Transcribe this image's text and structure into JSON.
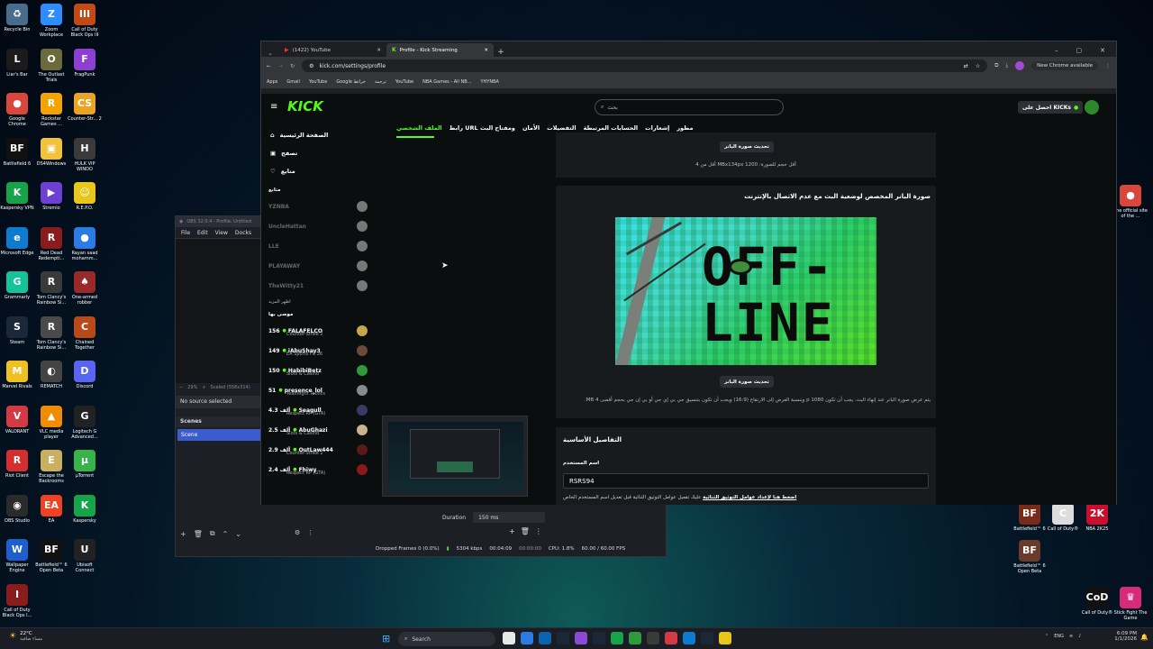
{
  "desktop_left": [
    {
      "label": "Recycle Bin",
      "color": "#4a6c8c",
      "glyph": "♻"
    },
    {
      "label": "Zoom Workplace",
      "color": "#2d8cff",
      "glyph": "Z"
    },
    {
      "label": "Call of Duty Black Ops III",
      "color": "#c24a14",
      "glyph": "III"
    },
    {
      "label": "Liar's Bar",
      "color": "#1b1b1b",
      "glyph": "L"
    },
    {
      "label": "The Outlast Trials",
      "color": "#6b6a3c",
      "glyph": "O"
    },
    {
      "label": "FragPunk",
      "color": "#8c3fd0",
      "glyph": "F"
    },
    {
      "label": "Google Chrome",
      "color": "#d9473c",
      "glyph": "●"
    },
    {
      "label": "Rockstar Games ...",
      "color": "#f4a300",
      "glyph": "R"
    },
    {
      "label": "Counter-Str... 2",
      "color": "#e8a422",
      "glyph": "CS"
    },
    {
      "label": "Battlefield 6",
      "color": "#111",
      "glyph": "BF"
    },
    {
      "label": "DS4Windows",
      "color": "#f2c23a",
      "glyph": "▣"
    },
    {
      "label": "HULK VIP WINDO",
      "color": "#3a3a3a",
      "glyph": "H"
    },
    {
      "label": "Kaspersky VPN",
      "color": "#17a34a",
      "glyph": "K"
    },
    {
      "label": "Stremio",
      "color": "#6d3fd2",
      "glyph": "▶"
    },
    {
      "label": "R.E.P.O.",
      "color": "#e8c61a",
      "glyph": "☺"
    },
    {
      "label": "Microsoft Edge",
      "color": "#0c7bd0",
      "glyph": "e"
    },
    {
      "label": "Red Dead Redempti...",
      "color": "#8a1c1c",
      "glyph": "R"
    },
    {
      "label": "Rayan saad mohamm...",
      "color": "#2a7be4",
      "glyph": "●"
    },
    {
      "label": "Grammarly",
      "color": "#15c39a",
      "glyph": "G"
    },
    {
      "label": "Tom Clancy's Rainbow Si...",
      "color": "#3a3a3a",
      "glyph": "R"
    },
    {
      "label": "One-armed robber",
      "color": "#9a2a2a",
      "glyph": "♠"
    },
    {
      "label": "Steam",
      "color": "#1b2838",
      "glyph": "S"
    },
    {
      "label": "Tom Clancy's Rainbow Si...",
      "color": "#4a4a4a",
      "glyph": "R"
    },
    {
      "label": "Chained Together",
      "color": "#b84a1a",
      "glyph": "C"
    },
    {
      "label": "Marvel Rivals",
      "color": "#f0c020",
      "glyph": "M"
    },
    {
      "label": "REMATCH",
      "color": "#444",
      "glyph": "◐"
    },
    {
      "label": "Discord",
      "color": "#5865f2",
      "glyph": "D"
    },
    {
      "label": "VALORANT",
      "color": "#d33a44",
      "glyph": "V"
    },
    {
      "label": "VLC media player",
      "color": "#f08c00",
      "glyph": "▲"
    },
    {
      "label": "Logitech G Advanced...",
      "color": "#222",
      "glyph": "G"
    },
    {
      "label": "Riot Client",
      "color": "#d42e2e",
      "glyph": "R"
    },
    {
      "label": "Escape the Backrooms",
      "color": "#c8b060",
      "glyph": "E"
    },
    {
      "label": "µTorrent",
      "color": "#38b34a",
      "glyph": "µ"
    },
    {
      "label": "OBS Studio",
      "color": "#2b2b2b",
      "glyph": "◉"
    },
    {
      "label": "EA",
      "color": "#f04123",
      "glyph": "EA"
    },
    {
      "label": "Kaspersky",
      "color": "#17a34a",
      "glyph": "K"
    },
    {
      "label": "Wallpaper Engine",
      "color": "#1e5fd0",
      "glyph": "W"
    },
    {
      "label": "Battlefield™ 6 Open Beta",
      "color": "#111",
      "glyph": "BF"
    },
    {
      "label": "Ubisoft Connect",
      "color": "#222",
      "glyph": "U"
    },
    {
      "label": "Call of Duty Black Ops I...",
      "color": "#8a1c1c",
      "glyph": "I"
    }
  ],
  "desktop_right": [
    {
      "label": "The official site of the ...",
      "color": "#d9473c",
      "glyph": "●"
    },
    {
      "label": "Battlefield™ 6",
      "color": "#7a2a1a",
      "glyph": "BF"
    },
    {
      "label": "Call of Duty®",
      "color": "#dddddd",
      "glyph": "C"
    },
    {
      "label": "NBA 2K25",
      "color": "#c8102e",
      "glyph": "2K"
    },
    {
      "label": "Battlefield™ 6 Open Beta",
      "color": "#6a3a2a",
      "glyph": "BF"
    },
    {
      "label": "Call of Duty®",
      "color": "#111",
      "glyph": "CoD"
    },
    {
      "label": "Stick Fight The Game",
      "color": "#d82a7a",
      "glyph": "♛"
    }
  ],
  "obs": {
    "title": "OBS 32.0.4 - Profile: Untitled",
    "menu": [
      "File",
      "Edit",
      "View",
      "Docks"
    ],
    "zoom": "29%",
    "scaled": "Scaled (558x314)",
    "no_source": "No source selected",
    "scenes_title": "Scenes",
    "scene_item": "Scene",
    "duration_label": "Duration",
    "duration_value": "150 ms",
    "status": {
      "dropped": "Dropped Frames 0 (0.0%)",
      "kbps": "5304 kbps",
      "time1": "00:04:09",
      "time2": "00:00:00",
      "cpu": "CPU: 1.8%",
      "fps": "60.00 / 60.00 FPS"
    }
  },
  "chrome": {
    "tabs": [
      "(1422) YouTube",
      "Profile - Kick Streaming"
    ],
    "url": "kick.com/settings/profile",
    "update": "New Chrome available",
    "bookmarks": [
      "Apps",
      "Gmail",
      "YouTube",
      "Google خرائط",
      "ترجمة",
      "YouTube",
      "NBA Games - All NB...",
      "YHYNBA"
    ]
  },
  "kick": {
    "logo": "KICK",
    "search_placeholder": "بحث",
    "get_kicks": "احصل على KICKs",
    "sidebar": [
      "الصفحة الرئيسية",
      "تصفح",
      "متابع"
    ],
    "following_title": "متابع",
    "offline_channels": [
      "YZNBA",
      "UncleHattan",
      "LLE",
      "PLAYAWAY",
      "TheWitty21"
    ],
    "show_more": "اظهر المزيد",
    "recommended_title": "موصى بها",
    "live": [
      {
        "viewers": "156",
        "name": "FALAFELCO",
        "game": "Counter-Strike 2",
        "color": "#c4a74a"
      },
      {
        "viewers": "149",
        "name": "iAbuShay3",
        "game": "EA Sports FC 26",
        "color": "#6a4a3a"
      },
      {
        "viewers": "150",
        "name": "HabibiBetz",
        "game": "Slots & Casino",
        "color": "#2e9a3a"
      },
      {
        "viewers": "51",
        "name": "presence_lol",
        "game": "Teamfight Tactics",
        "color": "#8a8a8a"
      },
      {
        "viewers": "4.3 ألف",
        "name": "Seagull",
        "game": "Respect RP (GTA)",
        "color": "#3a3a6a"
      },
      {
        "viewers": "2.5 ألف",
        "name": "AbuGhazi",
        "game": "Slots & Casino",
        "color": "#c8b48a"
      },
      {
        "viewers": "2.9 ألف",
        "name": "OutLaw444",
        "game": "Counter-Strike 2",
        "color": "#5a1a1a"
      },
      {
        "viewers": "2.4 ألف",
        "name": "Fhiwy",
        "game": "Respect RP (GTA)",
        "color": "#8a1a1a"
      }
    ],
    "tabs": [
      "الملف الشخصي",
      "رابط URL ومفتاح البث",
      "الأمان",
      "التفضيلات",
      "الحسابات المرتبطة",
      "إشعارات",
      "مطور"
    ],
    "update_banner_btn": "تحديث صورة البانر",
    "banner_hint": "أقل من 4 MBx134px أقل حجم للصورة: 1200",
    "offline_title": "صورة البانر المخصص لوضعية البث مع عدم الاتصال بالإنترنت",
    "offline_art_line1": "OFF-",
    "offline_art_line2": "LINE",
    "offline_btn": "تحديث صورة البانر",
    "offline_hint1": "يتم عرض صورة البانر عند إنهاء البث. يجب أن تكون 1080 p وبنسبة العرض إلى الارتفاع (16:9) ويجب أن تكون بتنسيق جي بي إي جي أو بي إن جي بحجم أقصى",
    "offline_hint2": "4 MB.",
    "basic_title": "التفاصيل الأساسية",
    "username_label": "اسم المستخدم",
    "username_value": "RSRS94",
    "twofa_link": "اضغط هنا لإعداد عوامل التوثيق الثنائية",
    "twofa_text": "عليك تفعيل عوامل التوثيق الثنائية قبل تعديل اسم المستخدم الخاص"
  },
  "taskbar": {
    "weather_temp": "22°C",
    "weather_text": "مساء صافية",
    "search": "Search",
    "lang": "ENG",
    "time": "6:09 PM",
    "date": "1/1/2026"
  },
  "colors": {
    "kick_green": "#53fc18",
    "chrome_bg": "#35363a",
    "obs_scene": "#3b5ccc"
  }
}
